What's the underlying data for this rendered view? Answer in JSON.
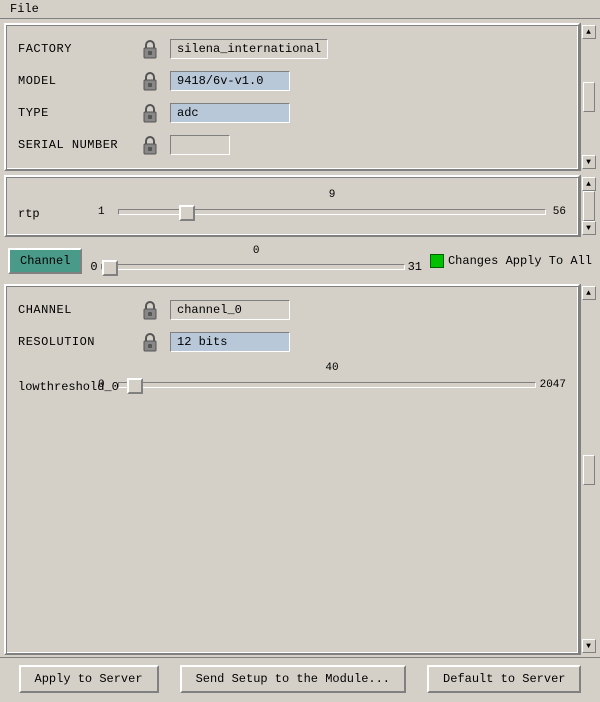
{
  "menubar": {
    "items": [
      "File"
    ]
  },
  "panel1": {
    "rows": [
      {
        "label": "FACTORY",
        "value": "silena_international",
        "value_style": "plain"
      },
      {
        "label": "MODEL",
        "value": "9418/6v-v1.0",
        "value_style": "blue"
      },
      {
        "label": "TYPE",
        "value": "adc",
        "value_style": "blue"
      },
      {
        "label": "SERIAL NUMBER",
        "value": "",
        "value_style": "plain"
      }
    ]
  },
  "panel2": {
    "slider": {
      "label": "rtp",
      "min": 1,
      "max": 56,
      "value": 9,
      "percent": 14
    }
  },
  "channel_row": {
    "btn_label": "Channel",
    "min": 0,
    "max": 31,
    "value": 0,
    "percent": 0,
    "changes_label": "Changes Apply To All"
  },
  "panel3": {
    "rows": [
      {
        "label": "CHANNEL",
        "value": "channel_0",
        "value_style": "plain"
      },
      {
        "label": "RESOLUTION",
        "value": "12 bits",
        "value_style": "blue"
      }
    ],
    "slider": {
      "label": "lowthreshold_0",
      "min": 0,
      "max": 2047,
      "value": 40,
      "percent": 2
    }
  },
  "footer": {
    "btn1": "Apply to Server",
    "btn2": "Send Setup to the Module...",
    "btn3": "Default to Server"
  }
}
